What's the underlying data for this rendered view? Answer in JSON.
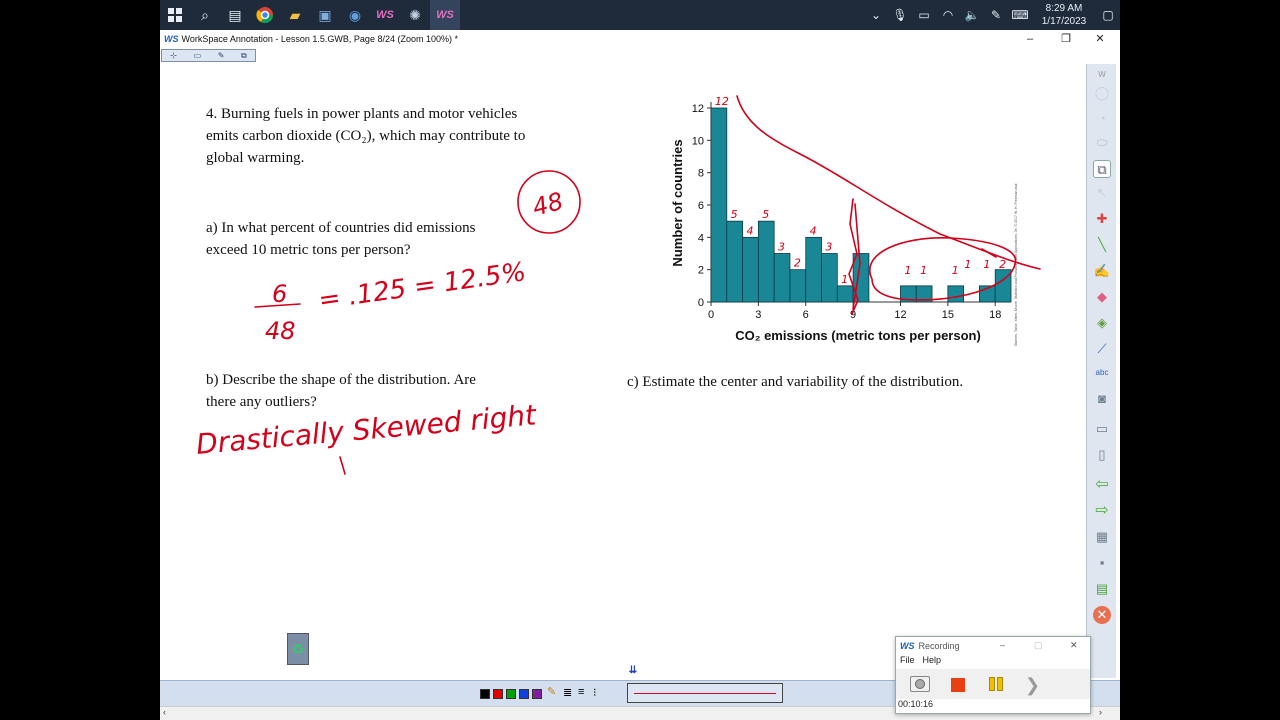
{
  "taskbar": {
    "apps": [
      "windows-start",
      "search",
      "task-view",
      "chrome",
      "file-explorer",
      "control-panel",
      "browser",
      "workspace",
      "paint",
      "workspace-active"
    ],
    "ws_label": "WS",
    "time": "8:29 AM",
    "date": "1/17/2023"
  },
  "window": {
    "app_badge": "WS",
    "title": "WorkSpace Annotation - Lesson 1.5.GWB, Page 8/24  (Zoom 100%) *",
    "minimize": "–",
    "restore": "❐",
    "close": "✕"
  },
  "toolbar": {
    "icons": [
      "⊹",
      "▭",
      "✎",
      "⧉"
    ]
  },
  "worksheet": {
    "q4": "4.  Burning fuels in power plants and motor vehicles emits carbon dioxide (CO₂), which may contribute to global warming.",
    "qa": "a) In what percent of countries did emissions exceed 10 metric tons per person?",
    "qb": "b) Describe the shape of the distribution. Are there any outliers?",
    "qc": "c) Estimate the center and variability of the distribution."
  },
  "chart_data": {
    "type": "bar",
    "xlabel": "CO₂ emissions (metric tons per person)",
    "ylabel": "Number of countries",
    "source": "Starnes, Tabor, Yates, Moore, Statistics and Probability with Applications, 3e, © 2017 W. H. Freeman and",
    "x_ticks": [
      0,
      3,
      6,
      9,
      12,
      15,
      18
    ],
    "y_ticks": [
      0,
      2,
      4,
      6,
      8,
      10,
      12
    ],
    "bin_width": 1,
    "ylim": [
      0,
      12
    ],
    "xlim": [
      0,
      19
    ],
    "bins_start": [
      0,
      1,
      2,
      3,
      4,
      5,
      6,
      7,
      8,
      9,
      10,
      11,
      12,
      13,
      14,
      15,
      16,
      17,
      18
    ],
    "values": [
      12,
      5,
      4,
      5,
      3,
      2,
      4,
      3,
      1,
      3,
      0,
      0,
      1,
      1,
      0,
      1,
      0,
      1,
      2
    ]
  },
  "ink": {
    "total_circle": "48",
    "fraction_num": "6",
    "fraction_den": "48",
    "fraction_result": "= .125 = 12.5%",
    "shape_answer": "Drastically Skewed right",
    "bar_labels": [
      "12",
      "5",
      "4",
      "5",
      "3",
      "2",
      "4",
      "3",
      "1",
      "1",
      "1",
      "1",
      "1",
      "1",
      "2"
    ],
    "ink_color": "#d4001a"
  },
  "bottombar": {
    "colors": [
      "#000000",
      "#e00000",
      "#00a000",
      "#1040e0",
      "#8020a0"
    ],
    "icons": [
      "≣",
      "≡",
      "⁝"
    ]
  },
  "recording": {
    "badge": "WS",
    "title": "Recording",
    "menu_file": "File",
    "menu_help": "Help",
    "time": "00:10:16"
  }
}
